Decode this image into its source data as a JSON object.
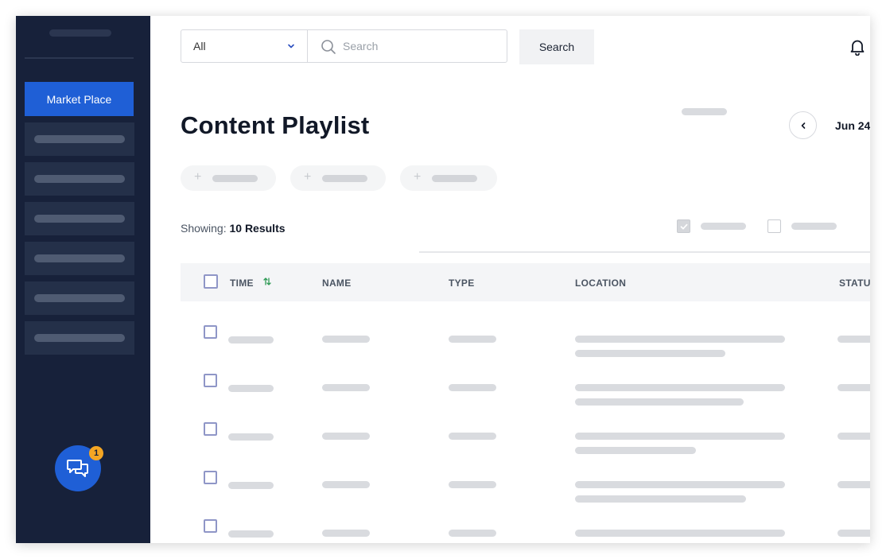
{
  "sidebar": {
    "active_item": {
      "label": "Market Place"
    },
    "placeholder_items": 6,
    "chat": {
      "icon": "chat-bubbles-icon",
      "badge": "1"
    }
  },
  "toolbar": {
    "filter_value": "All",
    "search_placeholder": "Search",
    "search_button": "Search",
    "notification_icon": "bell-icon"
  },
  "page": {
    "title": "Content Playlist",
    "date": "Jun 24",
    "showing_label": "Showing:",
    "showing_value": "10 Results"
  },
  "table": {
    "columns": [
      "TIME",
      "NAME",
      "TYPE",
      "LOCATION",
      "STATUS"
    ],
    "row_count_visible": 5
  },
  "colors": {
    "sidebar_bg": "#17213a",
    "accent": "#1f5fd6",
    "badge": "#f5a623"
  }
}
